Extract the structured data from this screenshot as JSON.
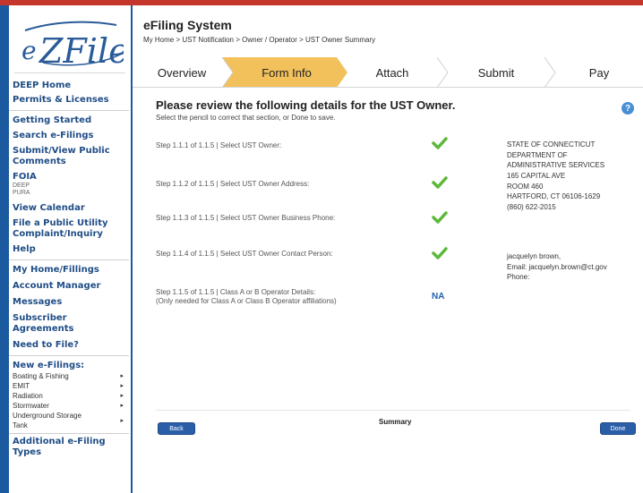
{
  "logo": {
    "text": "eZFile"
  },
  "sidebar": {
    "items": [
      {
        "label": "DEEP Home"
      },
      {
        "label": "Permits & Licenses"
      },
      {
        "label": "Getting Started"
      },
      {
        "label": "Search e-Filings"
      },
      {
        "label": "Submit/View Public Comments"
      },
      {
        "label": "FOIA"
      },
      {
        "label": "View Calendar"
      },
      {
        "label": "File a Public Utility Complaint/Inquiry"
      },
      {
        "label": "Help"
      },
      {
        "label": "My Home/Fillings"
      },
      {
        "label": "Account Manager"
      },
      {
        "label": "Messages"
      },
      {
        "label": "Subscriber Agreements"
      },
      {
        "label": "Need to File?"
      },
      {
        "label": "New e-Filings:"
      },
      {
        "label": "Additional e-Filing Types"
      }
    ],
    "foia_subs": [
      "DEEP",
      "PURA"
    ],
    "efilings": [
      {
        "label": "Boating & Fishing"
      },
      {
        "label": "EMIT"
      },
      {
        "label": "Radiation"
      },
      {
        "label": "Stormwater"
      },
      {
        "label": "Underground Storage Tank"
      }
    ],
    "arrow": "▸"
  },
  "header": {
    "title": "eFiling System",
    "breadcrumb": "My Home > UST Notification > Owner / Operator > UST Owner Summary"
  },
  "steps": [
    "Overview",
    "Form Info",
    "Attach",
    "Submit",
    "Pay"
  ],
  "review": {
    "title": "Please review the following details for the UST Owner.",
    "subtitle": "Select the pencil to correct that section, or Done to save.",
    "help": "?",
    "rows": [
      {
        "label": "Step 1.1.1 of 1.1.5 | Select UST Owner:",
        "status": "check",
        "value": [
          "STATE OF CONNECTICUT",
          "DEPARTMENT OF",
          "ADMINISTRATIVE SERVICES"
        ]
      },
      {
        "label": "Step 1.1.2 of 1.1.5 | Select UST Owner Address:",
        "status": "check",
        "value": [
          "165 CAPITAL AVE",
          "ROOM 460",
          "HARTFORD, CT 06106-1629"
        ]
      },
      {
        "label": "Step 1.1.3 of 1.1.5 | Select UST Owner Business Phone:",
        "status": "check",
        "value": [
          "(860) 622-2015"
        ]
      },
      {
        "label": "Step 1.1.4 of 1.1.5 | Select UST Owner Contact Person:",
        "status": "check",
        "value": [
          "jacquelyn brown,",
          "Email: jacquelyn.brown@ct.gov",
          "Phone:"
        ]
      },
      {
        "label": "Step 1.1.5 of 1.1.5 | Class A or B Operator Details:",
        "label2": "(Only needed for Class A or Class B Operator affiliations)",
        "status": "NA",
        "value": []
      }
    ]
  },
  "footer": {
    "summary": "Summary",
    "back": "Back",
    "done": "Done"
  },
  "colors": {
    "accent": "#f3c15b",
    "brand": "#1c5aa0",
    "check": "#5cb83a",
    "topbar": "#c4362b"
  }
}
